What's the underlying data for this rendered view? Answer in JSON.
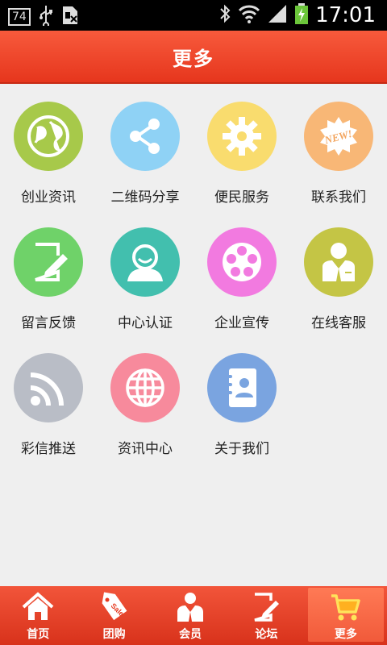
{
  "status": {
    "battery_level": "74",
    "time": "17:01"
  },
  "header": {
    "title": "更多"
  },
  "grid": [
    {
      "label": "创业资讯",
      "icon": "globe-icon",
      "color": "#a7c94a"
    },
    {
      "label": "二维码分享",
      "icon": "share-icon",
      "color": "#8fd2f5"
    },
    {
      "label": "便民服务",
      "icon": "gear-icon",
      "color": "#f9dc6e"
    },
    {
      "label": "联系我们",
      "icon": "new-badge-icon",
      "color": "#f8b776"
    },
    {
      "label": "留言反馈",
      "icon": "edit-icon",
      "color": "#6fd269"
    },
    {
      "label": "中心认证",
      "icon": "user-icon",
      "color": "#42bfae"
    },
    {
      "label": "企业宣传",
      "icon": "film-reel-icon",
      "color": "#f27ae0"
    },
    {
      "label": "在线客服",
      "icon": "support-agent-icon",
      "color": "#c4c545"
    },
    {
      "label": "彩信推送",
      "icon": "rss-icon",
      "color": "#b9bdc6"
    },
    {
      "label": "资讯中心",
      "icon": "web-globe-icon",
      "color": "#f78a9c"
    },
    {
      "label": "关于我们",
      "icon": "contacts-book-icon",
      "color": "#7aa4e0"
    }
  ],
  "tabbar": [
    {
      "label": "首页",
      "icon": "home-icon"
    },
    {
      "label": "团购",
      "icon": "sale-tag-icon",
      "tag_text": "Sale"
    },
    {
      "label": "会员",
      "icon": "member-icon"
    },
    {
      "label": "论坛",
      "icon": "forum-edit-icon"
    },
    {
      "label": "更多",
      "icon": "cart-icon",
      "active": true
    }
  ]
}
